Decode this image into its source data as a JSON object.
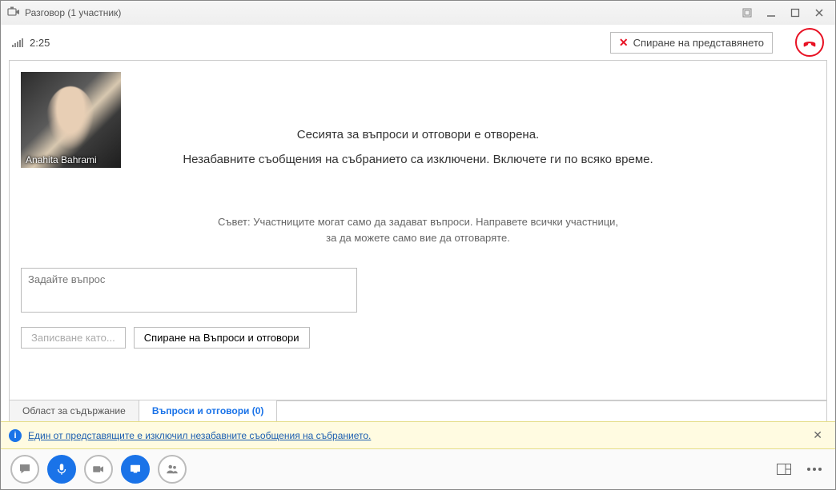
{
  "window": {
    "title": "Разговор (1 участник)"
  },
  "call": {
    "duration": "2:25",
    "stop_present_label": "Спиране на представянето"
  },
  "participant": {
    "name": "Anahita Bahrami"
  },
  "session": {
    "open_msg": "Сесията за въпроси и отговори е отворена.",
    "im_off_msg": "Незабавните съобщения на събранието са изключени. Включете ги по всяко време.",
    "tip_line1": "Съвет: Участниците могат само да задават въпроси. Направете всички участници,",
    "tip_line2": "за да можете само вие да отговаряте."
  },
  "input": {
    "question_placeholder": "Задайте въпрос",
    "save_as_label": "Записване като...",
    "stop_qa_label": "Спиране на Въпроси и отговори"
  },
  "tabs": {
    "content_area": "Област за съдържание",
    "qa": "Въпроси и отговори (0)"
  },
  "notification": {
    "text": "Един от представящите е изключил незабавните съобщения на събранието."
  },
  "colors": {
    "accent": "#1a73e8",
    "danger": "#e81123",
    "notif_bg": "#fffbe1"
  }
}
